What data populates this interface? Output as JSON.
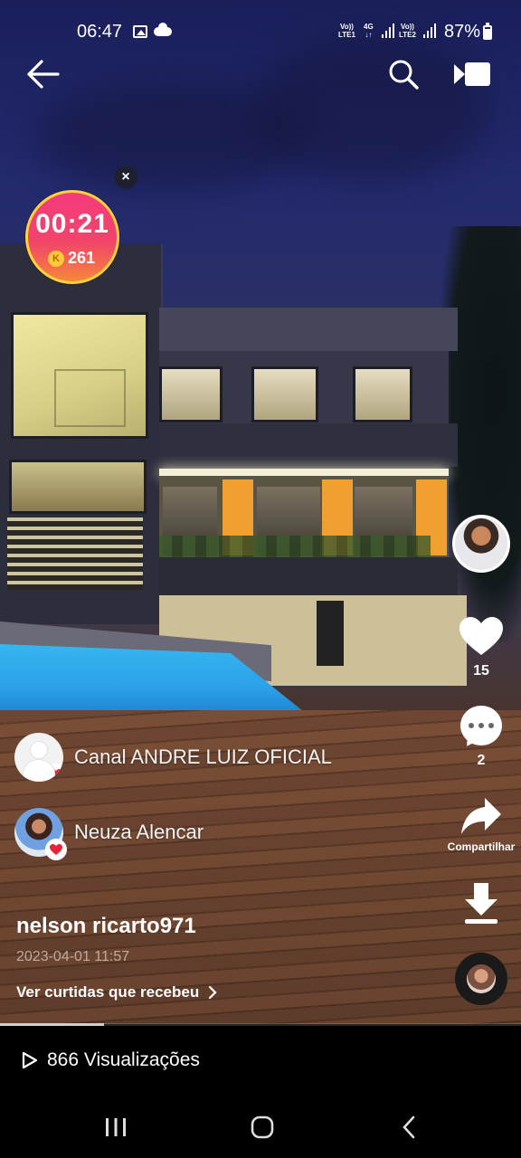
{
  "status_bar": {
    "time": "06:47",
    "sim1_top": "Vo))",
    "sim1_bottom": "LTE1",
    "net_top": "4G",
    "net_bottom": "↓↑",
    "sim2_top": "Vo))",
    "sim2_bottom": "LTE2",
    "battery": "87%",
    "icons": [
      "image-icon",
      "cloud-icon",
      "signal-icon",
      "battery-icon"
    ]
  },
  "top_bar": {
    "icons": [
      "back-arrow-icon",
      "search-icon",
      "video-camera-icon"
    ]
  },
  "timer_widget": {
    "time": "00:21",
    "coin_symbol": "K",
    "coins": "261",
    "close_symbol": "×"
  },
  "right_rail": {
    "likes": "15",
    "comments": "2",
    "share_label": "Compartilhar",
    "icons": [
      "heart-icon",
      "comment-icon",
      "share-icon",
      "download-icon",
      "music-disc-icon"
    ]
  },
  "likers": [
    {
      "name": "Canal ANDRE LUIZ OFICIAL"
    },
    {
      "name": "Neuza Alencar"
    }
  ],
  "post": {
    "username": "nelson ricarto971",
    "date": "2023-04-01 11:57",
    "received_likes_link": "Ver curtidas que recebeu"
  },
  "playback": {
    "progress": 0.2,
    "views": "866 Visualizações"
  },
  "colors": {
    "timer_top": "#f43b7c",
    "timer_bottom": "#f4883a",
    "timer_ring": "#ffd23c",
    "heart_badge": "#e8243c",
    "coin": "#ffc93a"
  }
}
